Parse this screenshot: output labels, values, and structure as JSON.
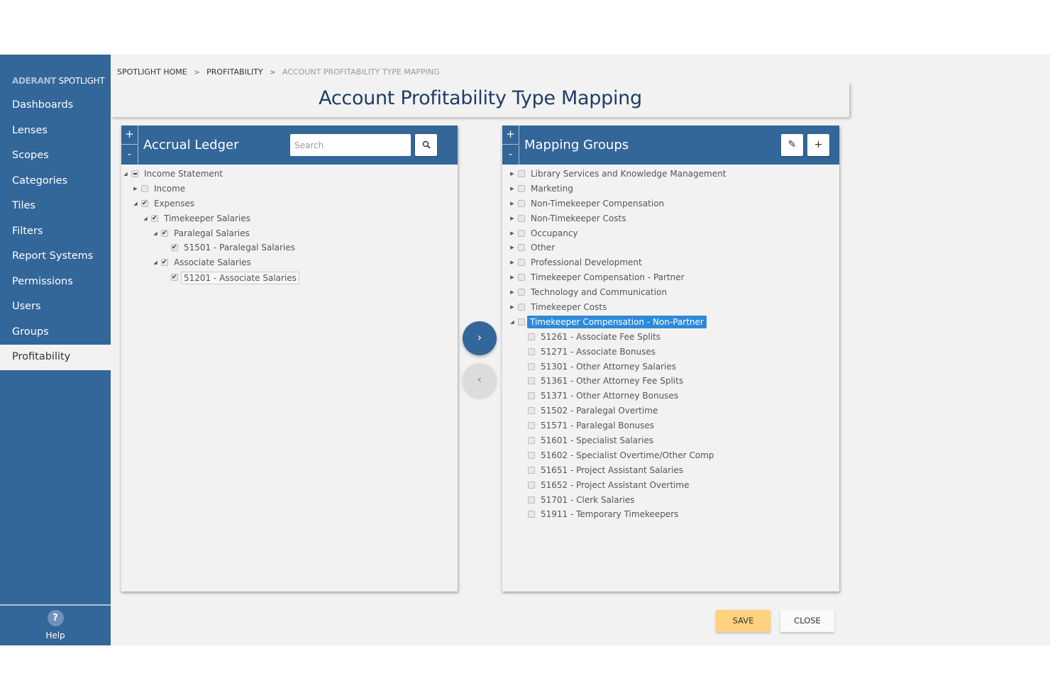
{
  "sidebar": {
    "brand_bold": "ADERANT",
    "brand_light": "SPOTLIGHT",
    "items": [
      {
        "label": "Dashboards"
      },
      {
        "label": "Lenses"
      },
      {
        "label": "Scopes"
      },
      {
        "label": "Categories"
      },
      {
        "label": "Tiles"
      },
      {
        "label": "Filters"
      },
      {
        "label": "Report Systems"
      },
      {
        "label": "Permissions"
      },
      {
        "label": "Users"
      },
      {
        "label": "Groups"
      },
      {
        "label": "Profitability",
        "active": true
      }
    ],
    "help_icon": "?",
    "help_label": "Help"
  },
  "breadcrumb": {
    "items": [
      "SPOTLIGHT HOME",
      "PROFITABILITY",
      "ACCOUNT PROFITABILITY TYPE MAPPING"
    ],
    "separator": ">"
  },
  "page_title": "Account Profitability Type Mapping",
  "left_panel": {
    "expand_label": "+",
    "collapse_label": "-",
    "title": "Accrual Ledger",
    "search_placeholder": "Search",
    "search_value": "",
    "search_icon": "search-icon",
    "tree": [
      {
        "label": "Income Statement",
        "level": 0,
        "toggle": "expanded",
        "state": "partial"
      },
      {
        "label": "Income",
        "level": 1,
        "toggle": "collapsed",
        "state": "unchecked"
      },
      {
        "label": "Expenses",
        "level": 1,
        "toggle": "expanded",
        "state": "checked"
      },
      {
        "label": "Timekeeper Salaries",
        "level": 2,
        "toggle": "expanded",
        "state": "checked"
      },
      {
        "label": "Paralegal Salaries",
        "level": 3,
        "toggle": "expanded",
        "state": "checked"
      },
      {
        "label": "51501 - Paralegal Salaries",
        "level": 4,
        "toggle": "none",
        "state": "checked"
      },
      {
        "label": "Associate Salaries",
        "level": 3,
        "toggle": "expanded",
        "state": "checked"
      },
      {
        "label": "51201 - Associate Salaries",
        "level": 4,
        "toggle": "none",
        "state": "checked",
        "focused": true
      }
    ]
  },
  "transfer": {
    "move_right_icon": "›",
    "move_left_icon": "‹"
  },
  "right_panel": {
    "expand_label": "+",
    "collapse_label": "-",
    "title": "Mapping Groups",
    "edit_icon": "✎",
    "add_icon": "+",
    "tree": [
      {
        "label": "Library Services and Knowledge Management",
        "level": 0,
        "toggle": "collapsed",
        "state": "unchecked"
      },
      {
        "label": "Marketing",
        "level": 0,
        "toggle": "collapsed",
        "state": "unchecked"
      },
      {
        "label": "Non-Timekeeper Compensation",
        "level": 0,
        "toggle": "collapsed",
        "state": "unchecked"
      },
      {
        "label": "Non-Timekeeper Costs",
        "level": 0,
        "toggle": "collapsed",
        "state": "unchecked"
      },
      {
        "label": "Occupancy",
        "level": 0,
        "toggle": "collapsed",
        "state": "unchecked"
      },
      {
        "label": "Other",
        "level": 0,
        "toggle": "collapsed",
        "state": "unchecked"
      },
      {
        "label": "Professional Development",
        "level": 0,
        "toggle": "collapsed",
        "state": "unchecked"
      },
      {
        "label": "Timekeeper Compensation - Partner",
        "level": 0,
        "toggle": "collapsed",
        "state": "unchecked"
      },
      {
        "label": "Technology and Communication",
        "level": 0,
        "toggle": "collapsed",
        "state": "unchecked"
      },
      {
        "label": "Timekeeper Costs",
        "level": 0,
        "toggle": "collapsed",
        "state": "unchecked"
      },
      {
        "label": "Timekeeper Compensation - Non-Partner",
        "level": 0,
        "toggle": "expanded",
        "state": "unchecked",
        "selected": true
      },
      {
        "label": "51261 - Associate Fee Splits",
        "level": 1,
        "toggle": "none",
        "state": "unchecked"
      },
      {
        "label": "51271 - Associate Bonuses",
        "level": 1,
        "toggle": "none",
        "state": "unchecked"
      },
      {
        "label": "51301 - Other Attorney Salaries",
        "level": 1,
        "toggle": "none",
        "state": "unchecked"
      },
      {
        "label": "51361 - Other Attorney Fee Splits",
        "level": 1,
        "toggle": "none",
        "state": "unchecked"
      },
      {
        "label": "51371 - Other Attorney Bonuses",
        "level": 1,
        "toggle": "none",
        "state": "unchecked"
      },
      {
        "label": "51502 - Paralegal Overtime",
        "level": 1,
        "toggle": "none",
        "state": "unchecked"
      },
      {
        "label": "51571 - Paralegal Bonuses",
        "level": 1,
        "toggle": "none",
        "state": "unchecked"
      },
      {
        "label": "51601 - Specialist Salaries",
        "level": 1,
        "toggle": "none",
        "state": "unchecked"
      },
      {
        "label": "51602 - Specialist Overtime/Other Comp",
        "level": 1,
        "toggle": "none",
        "state": "unchecked"
      },
      {
        "label": "51651 - Project Assistant Salaries",
        "level": 1,
        "toggle": "none",
        "state": "unchecked"
      },
      {
        "label": "51652 - Project Assistant Overtime",
        "level": 1,
        "toggle": "none",
        "state": "unchecked"
      },
      {
        "label": "51701 - Clerk Salaries",
        "level": 1,
        "toggle": "none",
        "state": "unchecked"
      },
      {
        "label": "51911 - Temporary Timekeepers",
        "level": 1,
        "toggle": "none",
        "state": "unchecked"
      }
    ]
  },
  "footer": {
    "save_label": "SAVE",
    "close_label": "CLOSE"
  },
  "colors": {
    "primary": "#336699",
    "selected": "#2e8ad8",
    "save": "#ffd27f",
    "background": "#f2f2f2"
  }
}
